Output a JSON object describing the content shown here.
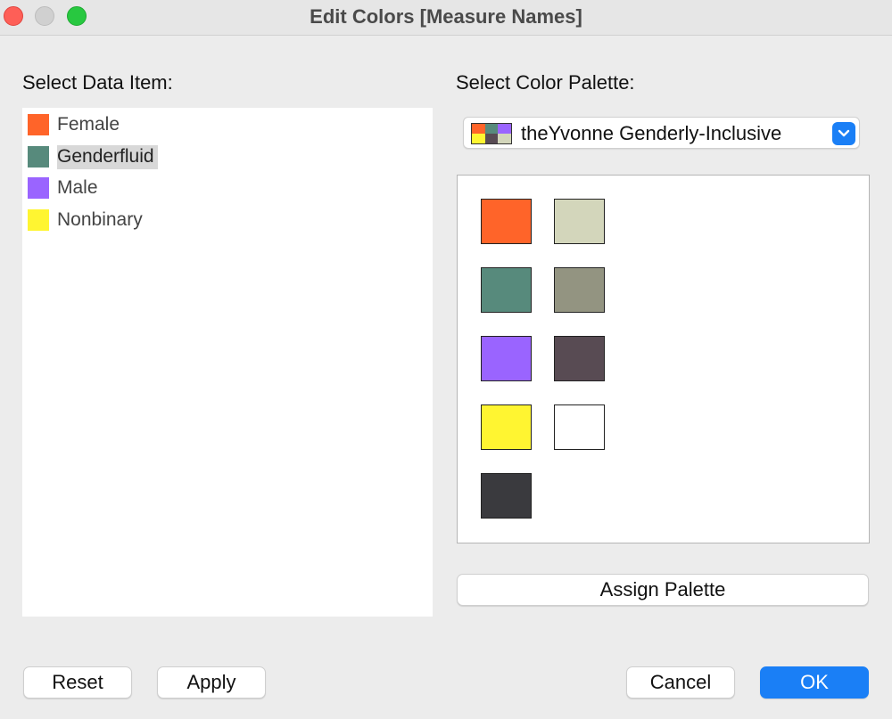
{
  "window": {
    "title": "Edit Colors [Measure Names]"
  },
  "data_panel": {
    "label": "Select Data Item:",
    "items": [
      {
        "label": "Female",
        "color": "#ff6429"
      },
      {
        "label": "Genderfluid",
        "color": "#578a7c",
        "selected": true
      },
      {
        "label": "Male",
        "color": "#9a64ff"
      },
      {
        "label": "Nonbinary",
        "color": "#fff531"
      }
    ]
  },
  "palette_panel": {
    "label": "Select Color Palette:",
    "selected_palette": "theYvonne Genderly-Inclusive",
    "dropdown_icon": "chevron-down-icon",
    "colors": [
      "#ff6429",
      "#d3d6bb",
      "#578a7c",
      "#939481",
      "#9a64ff",
      "#584b53",
      "#fff531",
      "#ffffff",
      "#3a3a3e"
    ],
    "assign_label": "Assign Palette"
  },
  "footer": {
    "reset_label": "Reset",
    "apply_label": "Apply",
    "cancel_label": "Cancel",
    "ok_label": "OK"
  },
  "colors": {
    "accent": "#1a7ff6",
    "close": "#fe5f57",
    "maximize": "#28c840"
  }
}
